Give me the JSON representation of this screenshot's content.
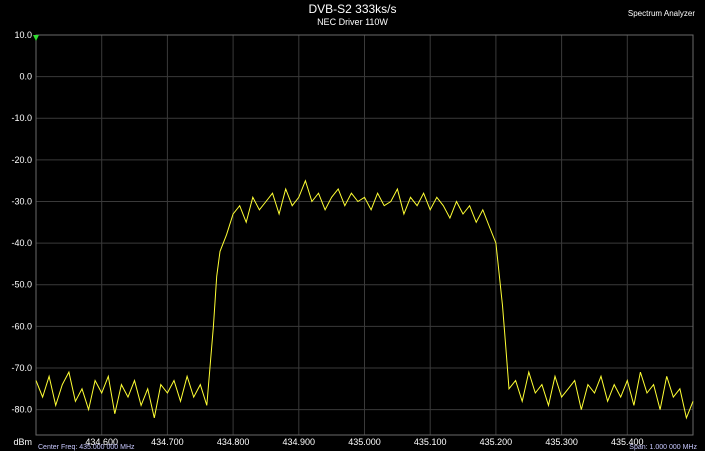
{
  "header": {
    "title": "DVB-S2 333ks/s",
    "subtitle": "NEC Driver 110W",
    "app_label": "Spectrum Analyzer"
  },
  "footer": {
    "center_freq": "Center Freq: 435.000 000 MHz",
    "span": "Span: 1.000 000 MHz"
  },
  "colors": {
    "background": "#000000",
    "grid": "#3a3a3a",
    "trace": "#ffff33",
    "marker": "#33dd33",
    "text": "#ffffff"
  },
  "chart_data": {
    "type": "line",
    "title": "DVB-S2 333ks/s",
    "subtitle": "NEC Driver 110W",
    "xlabel": "",
    "ylabel": "dBm",
    "xlim": [
      434.5,
      435.5
    ],
    "ylim": [
      -85,
      10
    ],
    "y_ticks": [
      10.0,
      0.0,
      -10.0,
      -20.0,
      -30.0,
      -40.0,
      -50.0,
      -60.0,
      -70.0,
      -80.0
    ],
    "y_tick_labels": [
      "10.0",
      "0.0",
      "-10.0",
      "-20.0",
      "-30.0",
      "-40.0",
      "-50.0",
      "-60.0",
      "-70.0",
      "-80.0"
    ],
    "x_ticks": [
      434.6,
      434.7,
      434.8,
      434.9,
      435.0,
      435.1,
      435.2,
      435.3,
      435.4
    ],
    "x_tick_labels": [
      "434.600",
      "434.700",
      "434.800",
      "434.900",
      "435.000",
      "435.100",
      "435.200",
      "435.300",
      "435.400"
    ],
    "grid": true,
    "series": [
      {
        "x": [
          434.5,
          434.51,
          434.52,
          434.53,
          434.54,
          434.55,
          434.56,
          434.57,
          434.58,
          434.59,
          434.6,
          434.61,
          434.62,
          434.63,
          434.64,
          434.65,
          434.66,
          434.67,
          434.68,
          434.69,
          434.7,
          434.71,
          434.72,
          434.73,
          434.74,
          434.75,
          434.76,
          434.77,
          434.775,
          434.78,
          434.79,
          434.8,
          434.81,
          434.82,
          434.83,
          434.84,
          434.85,
          434.86,
          434.87,
          434.88,
          434.89,
          434.9,
          434.91,
          434.92,
          434.93,
          434.94,
          434.95,
          434.96,
          434.97,
          434.98,
          434.99,
          435.0,
          435.01,
          435.02,
          435.03,
          435.04,
          435.05,
          435.06,
          435.07,
          435.08,
          435.09,
          435.1,
          435.11,
          435.12,
          435.13,
          435.14,
          435.15,
          435.16,
          435.17,
          435.18,
          435.19,
          435.2,
          435.21,
          435.215,
          435.22,
          435.23,
          435.24,
          435.25,
          435.26,
          435.27,
          435.28,
          435.29,
          435.3,
          435.31,
          435.32,
          435.33,
          435.34,
          435.35,
          435.36,
          435.37,
          435.38,
          435.39,
          435.4,
          435.41,
          435.42,
          435.43,
          435.44,
          435.45,
          435.46,
          435.47,
          435.48,
          435.49,
          435.5
        ],
        "y": [
          -73,
          -77,
          -72,
          -79,
          -74,
          -71,
          -78,
          -75,
          -80,
          -73,
          -76,
          -72,
          -81,
          -74,
          -77,
          -73,
          -79,
          -75,
          -82,
          -74,
          -76,
          -73,
          -78,
          -72,
          -77,
          -74,
          -79,
          -60,
          -48,
          -42,
          -38,
          -33,
          -31,
          -35,
          -29,
          -32,
          -30,
          -28,
          -33,
          -27,
          -31,
          -29,
          -25,
          -30,
          -28,
          -32,
          -29,
          -27,
          -31,
          -28,
          -30,
          -29,
          -32,
          -28,
          -31,
          -30,
          -27,
          -33,
          -29,
          -31,
          -28,
          -32,
          -29,
          -31,
          -34,
          -30,
          -33,
          -31,
          -35,
          -32,
          -36,
          -40,
          -55,
          -65,
          -75,
          -73,
          -78,
          -71,
          -76,
          -74,
          -79,
          -72,
          -77,
          -75,
          -73,
          -80,
          -74,
          -76,
          -72,
          -78,
          -74,
          -77,
          -73,
          -79,
          -71,
          -76,
          -74,
          -80,
          -72,
          -77,
          -75,
          -82,
          -78
        ]
      }
    ],
    "unit_label": "dBm",
    "marker": {
      "x": 434.5,
      "y": 10.0
    }
  }
}
